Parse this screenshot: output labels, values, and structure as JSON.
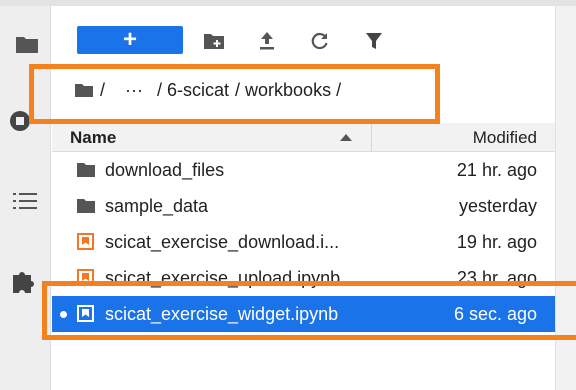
{
  "toolbar": {
    "new_label": "+"
  },
  "breadcrumb": {
    "root": "/",
    "ellipsis": "···",
    "seg1": "/ 6-scicat",
    "seg2": "/ workbooks /"
  },
  "header": {
    "name": "Name",
    "modified": "Modified"
  },
  "files": [
    {
      "name": "download_files",
      "modified": "21 hr. ago",
      "kind": "folder"
    },
    {
      "name": "sample_data",
      "modified": "yesterday",
      "kind": "folder"
    },
    {
      "name": "scicat_exercise_download.i...",
      "modified": "19 hr. ago",
      "kind": "notebook"
    },
    {
      "name": "scicat_exercise_upload.ipynb",
      "modified": "23 hr. ago",
      "kind": "notebook"
    },
    {
      "name": "scicat_exercise_widget.ipynb",
      "modified": "6 sec. ago",
      "kind": "notebook",
      "selected": true
    }
  ],
  "colors": {
    "accent": "#1a73e8",
    "notebook_icon": "#f37726",
    "highlight": "#f5801e"
  },
  "icons": {
    "activity": [
      "folder-icon",
      "running-icon",
      "toc-icon",
      "extension-icon"
    ],
    "toolbar": [
      "new-folder-icon",
      "upload-icon",
      "refresh-icon",
      "filter-icon"
    ]
  }
}
